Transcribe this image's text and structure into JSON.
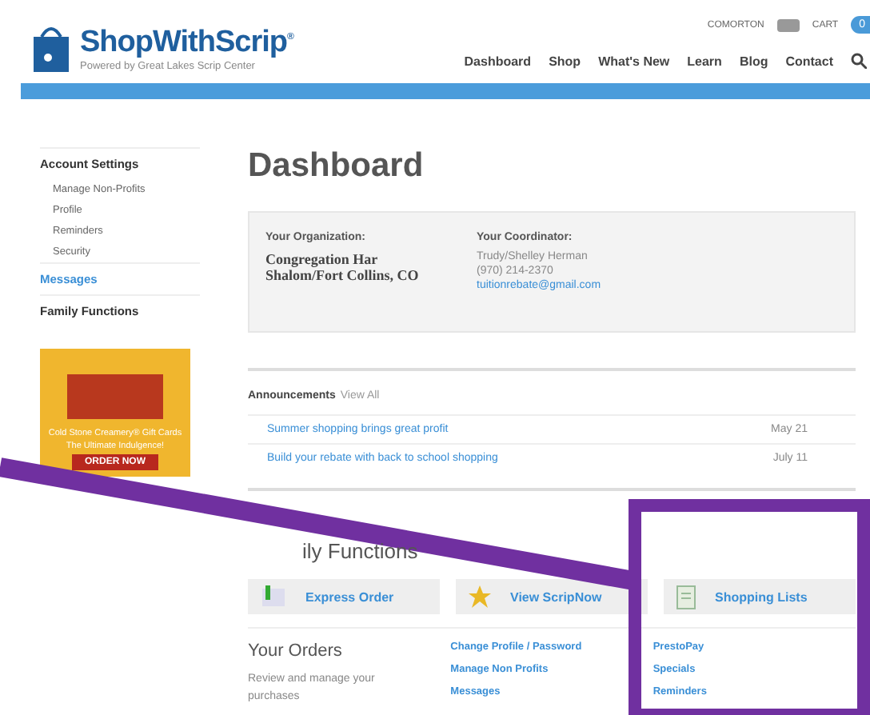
{
  "header": {
    "logo": {
      "name": "ShopWithScrip",
      "mark": "®",
      "tagline": "Powered by Great Lakes Scrip Center"
    },
    "user": "COMORTON",
    "cart": {
      "label": "CART",
      "count": "0"
    },
    "nav": [
      "Dashboard",
      "Shop",
      "What's New",
      "Learn",
      "Blog",
      "Contact"
    ]
  },
  "sidebar": {
    "sections": [
      {
        "title": "Account Settings",
        "kind": "heading",
        "items": [
          "Manage Non-Profits",
          "Profile",
          "Reminders",
          "Security"
        ]
      },
      {
        "title": "Messages",
        "kind": "link"
      },
      {
        "title": "Family Functions",
        "kind": "heading"
      }
    ],
    "ad": {
      "caption": "Cold Stone Creamery® Gift Cards",
      "subcaption": "The Ultimate Indulgence!",
      "button": "ORDER NOW"
    }
  },
  "page_title": "Dashboard",
  "organization": {
    "label": "Your Organization:",
    "name": "Congregation Har Shalom/Fort Collins, CO"
  },
  "coordinator": {
    "label": "Your Coordinator:",
    "name": "Trudy/Shelley Herman",
    "phone": "(970) 214-2370",
    "email": "tuitionrebate@gmail.com"
  },
  "announcements": {
    "title": "Announcements",
    "view_all": "View All",
    "items": [
      {
        "text": "Summer shopping brings great profit",
        "date": "May 21"
      },
      {
        "text": "Build your rebate with back to school shopping",
        "date": "July 11"
      }
    ]
  },
  "functions": {
    "title": "ily Functions",
    "buttons": [
      {
        "label": "Express Order",
        "kind": "express"
      },
      {
        "label": "View ScripNow",
        "kind": "scripnow"
      },
      {
        "label": "Shopping Lists",
        "kind": "list"
      }
    ]
  },
  "orders": {
    "title": "Your Orders",
    "description": "Review and manage your purchases",
    "links": [
      [
        "Change Profile / Password",
        "Manage Non Profits",
        "Messages"
      ],
      [
        "PrestoPay",
        "Specials",
        "Reminders"
      ]
    ]
  }
}
